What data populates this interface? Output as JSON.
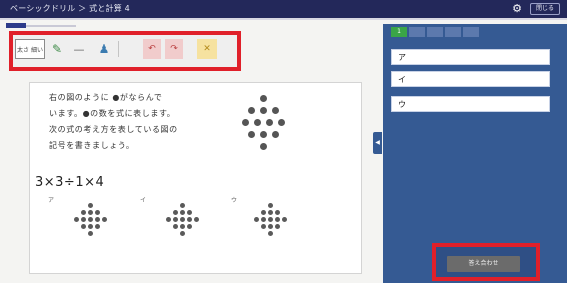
{
  "titlebar": {
    "title": "ベーシックドリル ＞ 式と計算 4",
    "gear_glyph": "⚙",
    "close_label": "閉じる"
  },
  "toolbar": {
    "pen_size_label": "太さ 細い",
    "pen_glyph": "✎",
    "line_glyph": "—",
    "stamp_glyph": "♟",
    "undo_glyph": "↶",
    "redo_glyph": "↷",
    "clear_glyph": "✕"
  },
  "question": {
    "lines": [
      "右の図のように ●がならんで",
      "います。●の数を式に表します。",
      "次の式の考え方を表している図の",
      "記号を書きましょう。"
    ],
    "expression": "3×3÷1×4",
    "options": [
      "ア",
      "イ",
      "ウ"
    ]
  },
  "answer_panel": {
    "active_tab": "1",
    "rows": [
      "ア",
      "イ",
      "ウ"
    ],
    "collapse_glyph": "◀",
    "submit_label": "答え合わせ"
  },
  "colors": {
    "titlebar": "#23285a",
    "panel": "#355a93",
    "highlight": "#e0202a"
  }
}
